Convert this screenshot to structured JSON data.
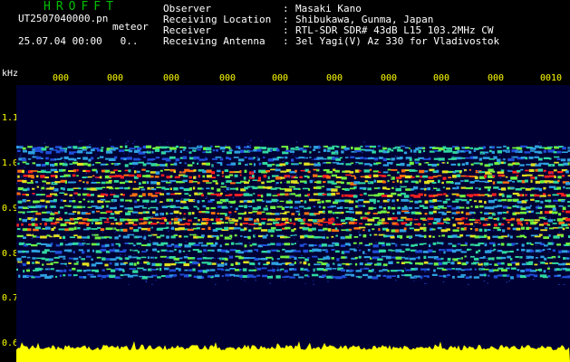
{
  "header": {
    "app_title": "HROFFT",
    "file_name": "UT2507040000.pn",
    "file_suffix": "meteor",
    "date_time": "25.07.04 00:00",
    "counter": "0.."
  },
  "info": [
    {
      "label": "Observer",
      "value": "Masaki Kano"
    },
    {
      "label": "Receiving Location",
      "value": "Shibukawa, Gunma, Japan"
    },
    {
      "label": "Receiver",
      "value": "RTL-SDR SDR# 43dB L15 103.2MHz CW"
    },
    {
      "label": "Receiving Antenna",
      "value": "3el Yagi(V) Az 330 for Vladivostok"
    }
  ],
  "separator": ":",
  "axis": {
    "unit": "kHz",
    "y_labels": [
      "1.1",
      "1.0",
      "0.9",
      "0.8",
      "0.7",
      "0.6"
    ],
    "x_labels": [
      "000",
      "000",
      "000",
      "000",
      "000",
      "000",
      "000",
      "000",
      "000",
      "0010"
    ]
  },
  "colors": {
    "background": "#000000",
    "plot_background": "#000033",
    "tick_label": "#ffff00",
    "title": "#00c000",
    "noise_floor": "#ffff00"
  }
}
